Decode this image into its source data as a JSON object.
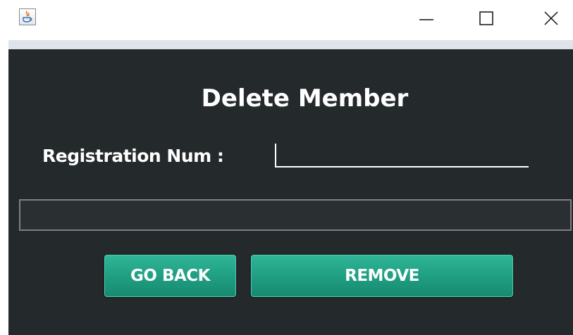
{
  "window": {
    "icon": "java-app-icon",
    "controls": {
      "minimize": "minimize-icon",
      "maximize": "maximize-icon",
      "close": "close-icon"
    }
  },
  "form": {
    "title": "Delete Member",
    "registration_label": "Registration Num :",
    "registration_value": "",
    "result_text": ""
  },
  "buttons": {
    "go_back": "GO BACK",
    "remove": "REMOVE"
  },
  "colors": {
    "panel_background": "#24292b",
    "button_green": "#1f9d80",
    "text": "#ffffff"
  }
}
